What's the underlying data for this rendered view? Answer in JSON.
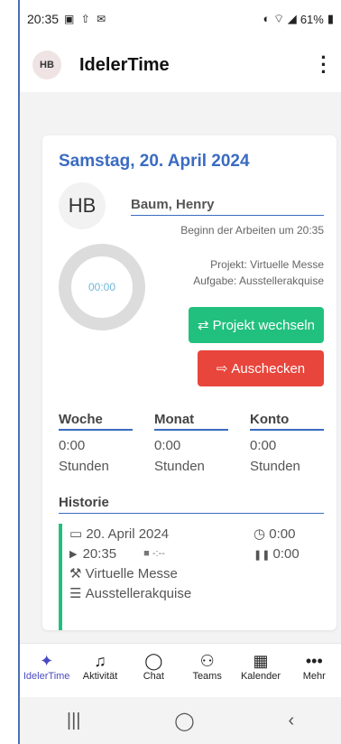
{
  "status_bar": {
    "time": "20:35",
    "battery": "61%"
  },
  "app_bar": {
    "avatar_initials": "HB",
    "title": "IdelerTime"
  },
  "card": {
    "date": "Samstag, 20. April 2024",
    "avatar_initials": "HB",
    "name": "Baum, Henry",
    "start_text": "Beginn der Arbeiten um 20:35",
    "timer": "00:00",
    "project": "Projekt: Virtuelle Messe",
    "task": "Aufgabe: Ausstellerakquise",
    "switch_button": "Projekt wechseln",
    "checkout_button": "Auschecken",
    "stats": [
      {
        "label": "Woche",
        "value": "0:00",
        "unit": "Stunden"
      },
      {
        "label": "Monat",
        "value": "0:00",
        "unit": "Stunden"
      },
      {
        "label": "Konto",
        "value": "0:00",
        "unit": "Stunden"
      }
    ],
    "history_title": "Historie",
    "history_item": {
      "date": "20. April 2024",
      "duration": "0:00",
      "start": "20:35",
      "end": "-:--",
      "pause": "0:00",
      "project": "Virtuelle Messe",
      "task": "Ausstellerakquise"
    }
  },
  "bottom_nav": [
    {
      "label": "IdelerTime",
      "icon": "logo-icon"
    },
    {
      "label": "Aktivität",
      "icon": "bell-icon"
    },
    {
      "label": "Chat",
      "icon": "chat-icon"
    },
    {
      "label": "Teams",
      "icon": "teams-icon"
    },
    {
      "label": "Kalender",
      "icon": "calendar-icon"
    },
    {
      "label": "Mehr",
      "icon": "more-icon"
    }
  ],
  "colors": {
    "accent": "#3a6bc2",
    "green": "#22c07e",
    "red": "#e8453c",
    "nav_active": "#4a4ac0"
  }
}
